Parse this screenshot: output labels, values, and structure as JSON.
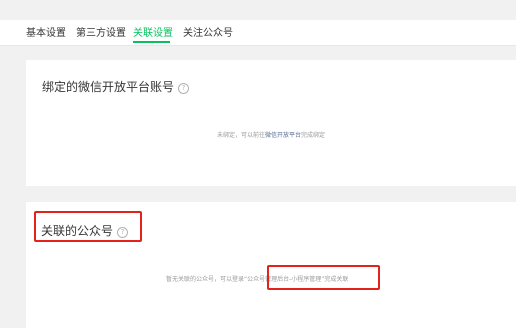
{
  "tabs": [
    {
      "label": "基本设置"
    },
    {
      "label": "第三方设置"
    },
    {
      "label": "关联设置"
    },
    {
      "label": "关注公众号"
    }
  ],
  "active_tab": "关联设置",
  "colors": {
    "accent": "#07c160",
    "link": "#576b95",
    "highlight_box": "#e2231a"
  },
  "bound_platform": {
    "title": "绑定的微信开放平台账号",
    "help_icon": "question-circle-icon",
    "empty_prefix": "未绑定，可以前往",
    "empty_link": "微信开放平台",
    "empty_suffix": "完成绑定"
  },
  "linked_accounts": {
    "title": "关联的公众号",
    "help_icon": "question-circle-icon",
    "empty_prefix": "暂无关联的公众号，可以登录",
    "empty_link": "“公众号管理后台-小程序管理”",
    "empty_suffix": "完成关联"
  }
}
